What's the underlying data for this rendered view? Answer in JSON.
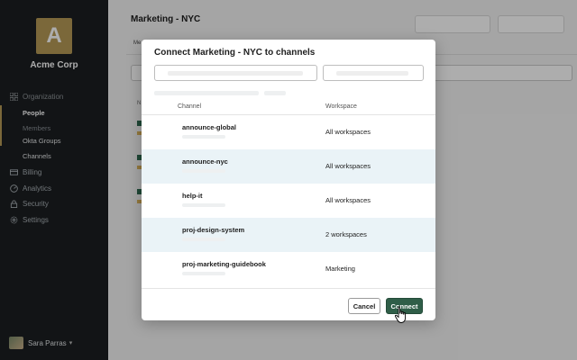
{
  "sidebar": {
    "logo_letter": "A",
    "org_name": "Acme Corp",
    "nav": {
      "organization": "Organization",
      "people": "People",
      "members": "Members",
      "okta_groups": "Okta Groups",
      "channels": "Channels",
      "billing": "Billing",
      "analytics": "Analytics",
      "security": "Security",
      "settings": "Settings"
    },
    "user_name": "Sara Parras"
  },
  "page": {
    "title": "Marketing - NYC",
    "tab_partial": "Me",
    "column_partial": "N"
  },
  "modal": {
    "title": "Connect Marketing - NYC to channels",
    "columns": {
      "channel": "Channel",
      "workspace": "Workspace"
    },
    "rows": [
      {
        "channel": "announce-global",
        "workspace": "All workspaces",
        "highlighted": false
      },
      {
        "channel": "announce-nyc",
        "workspace": "All workspaces",
        "highlighted": true
      },
      {
        "channel": "help-it",
        "workspace": "All workspaces",
        "highlighted": false
      },
      {
        "channel": "proj-design-system",
        "workspace": "2 workspaces",
        "highlighted": true
      },
      {
        "channel": "proj-marketing-guidebook",
        "workspace": "Marketing",
        "highlighted": false
      }
    ],
    "cancel_label": "Cancel",
    "connect_label": "Connect"
  },
  "colors": {
    "sidebar_bg": "#1b1e21",
    "accent_gold": "#b69a56",
    "connect_green": "#2f5e48",
    "row_highlight": "#eaf3f7"
  }
}
